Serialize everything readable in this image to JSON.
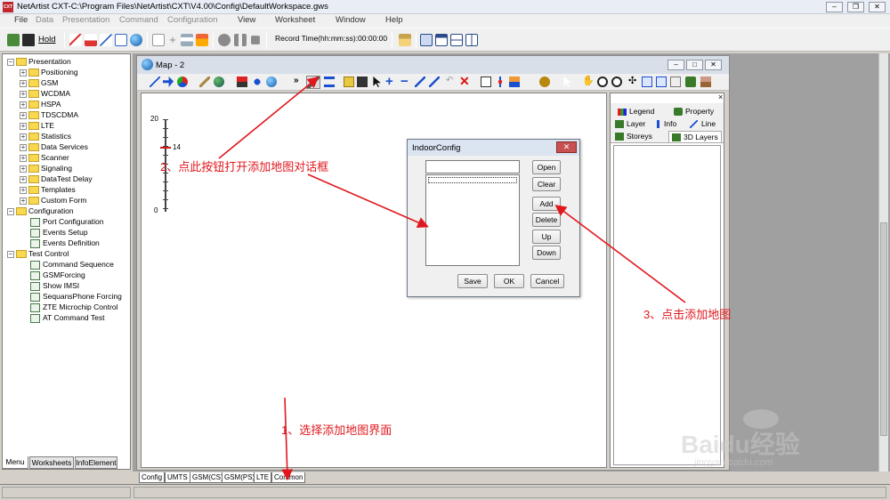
{
  "app": {
    "title": "NetArtist CXT-C:\\Program Files\\NetArtist\\CXT\\V4.00\\Config\\DefaultWorkspace.gws",
    "icon_label": "CXT",
    "window_buttons": [
      "–",
      "❐",
      "✕"
    ]
  },
  "menubar": {
    "items": [
      "File",
      "Data",
      "Presentation",
      "Command",
      "Configuration",
      "View",
      "Worksheet",
      "Window",
      "Help"
    ]
  },
  "toolbar": {
    "hold_label": "Hold",
    "record_time_label": "Record Time(hh:mm:ss):00:00:00"
  },
  "tree": {
    "presentation": "Presentation",
    "presentation_items": [
      "Positioning",
      "GSM",
      "WCDMA",
      "HSPA",
      "TDSCDMA",
      "LTE",
      "Statistics",
      "Data Services",
      "Scanner",
      "Signaling",
      "DataTest Delay",
      "Templates",
      "Custom Form"
    ],
    "configuration": "Configuration",
    "configuration_items": [
      "Port Configuration",
      "Events Setup",
      "Events Definition"
    ],
    "test_control": "Test Control",
    "test_control_items": [
      "Command Sequence",
      "GSMForcing",
      "Show IMSI",
      "SequansPhone Forcing",
      "ZTE Microchip Control",
      "AT Command Test"
    ]
  },
  "left_tabs": [
    "Menu",
    "Worksheets",
    "InfoElement"
  ],
  "map_window": {
    "title": "Map - 2",
    "controls": [
      "–",
      "□",
      "✕"
    ]
  },
  "scale": {
    "top": "20",
    "value": "14",
    "bottom": "0"
  },
  "right_panel": {
    "tabs_row1": [
      "Legend",
      "Property"
    ],
    "tabs_row2": [
      "Layer",
      "Info",
      "Line"
    ],
    "tabs_row3": [
      "Storeys",
      "3D Layers"
    ],
    "close": "×"
  },
  "dialog": {
    "title": "IndoorConfig",
    "close": "✕",
    "side_buttons": [
      "Open",
      "Clear",
      "Add",
      "Delete",
      "Up",
      "Down"
    ],
    "bottom_buttons": [
      "Save",
      "OK",
      "Cancel"
    ]
  },
  "sheet_tabs": [
    "Config",
    "UMTS",
    "GSM(CS)",
    "GSM(PS)",
    "LTE",
    "Common"
  ],
  "annotations": {
    "step1": "1、选择添加地图界面",
    "step2": "2、点此按钮打开添加地图对话框",
    "step3": "3、点击添加地图"
  },
  "watermark": {
    "brand": "Baidu经验",
    "url": "jingyan.baidu.com"
  },
  "colors": {
    "annotation_red": "#e0181e",
    "folder_yellow": "#f7d84f",
    "dialog_close_red": "#c75050"
  }
}
